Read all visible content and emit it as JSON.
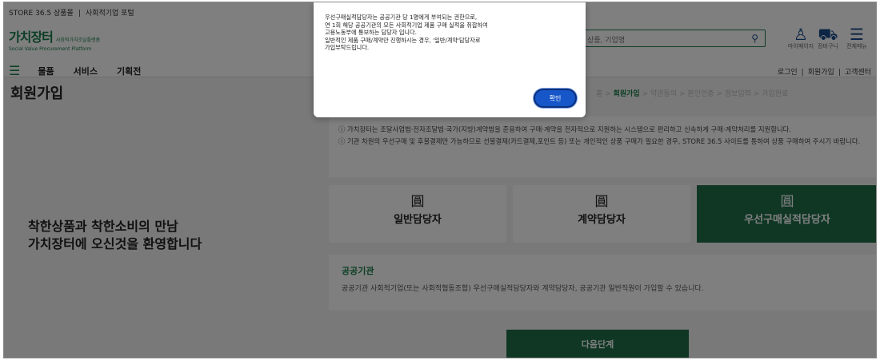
{
  "header": {
    "topbar": [
      "STORE 36.5 상품몰",
      "|",
      "사회적기업 포털"
    ],
    "logo_main": "가치장터",
    "logo_sub": "사회적가치조달플랫폼",
    "logo_en": "Social Value Procurement Platform",
    "search_placeholder": "상품, 기업명",
    "icons": [
      {
        "name": "user-icon",
        "label": "마이페이지"
      },
      {
        "name": "cart-icon",
        "label": "장바구니"
      },
      {
        "name": "menu-icon",
        "label": "전체메뉴"
      }
    ],
    "nav": [
      "물품",
      "서비스",
      "기획전"
    ],
    "util": [
      "로그인",
      "|",
      "회원가입",
      "|",
      "고객센터"
    ]
  },
  "page": {
    "title": "회원가입",
    "breadcrumb": [
      "홈",
      ">",
      "회원가입",
      ">",
      "약관동의",
      ">",
      "본인인증",
      ">",
      "정보입력",
      ">",
      "가입완료"
    ],
    "notices": [
      "ⓘ 가치장터는 조달사업법·전자조달법·국가(지방)계약법을 준용하여 구매·계약을 전자적으로 지원하는 시스템으로 편리하고 신속하게 구매·계약처리를 지원합니다.",
      "ⓘ 기관 차원의 우선구매 및 후불결제만 가능하므로 선불결제(카드결제,포인트 등) 또는 개인적인 상품 구매가 필요한 경우, STORE 36.5 사이트를 통하여 상품 구매하여 주시기 바랍니다."
    ],
    "welcome": [
      "착한상품과 착한소비의 만남",
      "가치장터에 오신것을 환영합니다"
    ],
    "member_types": [
      {
        "label": "일반담당자",
        "icon": "building-icon",
        "selected": false
      },
      {
        "label": "계약담당자",
        "icon": "building-icon",
        "selected": false
      },
      {
        "label": "우선구매실적담당자",
        "icon": "building-icon",
        "selected": true
      }
    ],
    "info_title": "공공기관",
    "info_text": "공공기관 사회적기업(또는 사회적협동조합) 우선구매실적담당자와 계약담당자, 공공기관 일반직원이 가입할 수 있습니다.",
    "next_label": "다음단계"
  },
  "dialog": {
    "lines": [
      "우선구매실적담당자는 공공기관 당 1명에게 부여되는 권한으로,",
      "연 1회 해당 공공기관의 모든 사회적기업 제품 구매 실적을 취합하여",
      "고용노동부에 통보하는 담당자 입니다.",
      "일반적인 제품 구매/계약만 진행하시는 경우, '일반/계약'담당자로",
      "가입부탁드립니다."
    ],
    "ok_label": "확인"
  },
  "colors": {
    "brand_green": "#1e6e48",
    "dialog_button": "#1656c9"
  }
}
